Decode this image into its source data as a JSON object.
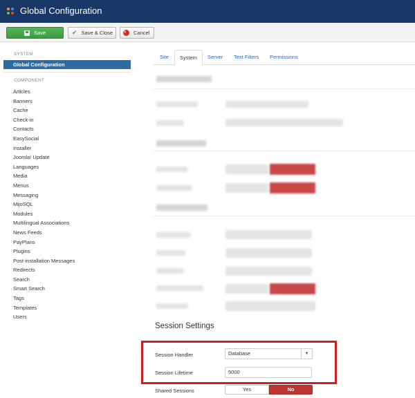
{
  "header": {
    "title": "Global Configuration",
    "logo_icon": "joomla-logo-icon"
  },
  "toolbar": {
    "save_label": "Save",
    "save_close_label": "Save & Close",
    "cancel_label": "Cancel"
  },
  "sidebar": {
    "system_heading": "SYSTEM",
    "active_item": "Global Configuration",
    "component_heading": "COMPONENT",
    "items": [
      "Articles",
      "Banners",
      "Cache",
      "Check-in",
      "Contacts",
      "EasySocial",
      "Installer",
      "Joomla! Update",
      "Languages",
      "Media",
      "Menus",
      "Messaging",
      "MijoSQL",
      "Modules",
      "Multilingual Associations",
      "News Feeds",
      "PayPlans",
      "Plugins",
      "Post-installation Messages",
      "Redirects",
      "Search",
      "Smart Search",
      "Tags",
      "Templates",
      "Users"
    ]
  },
  "tabs": [
    "Site",
    "System",
    "Server",
    "Text Filters",
    "Permissions"
  ],
  "active_tab": "System",
  "session": {
    "title": "Session Settings",
    "handler_label": "Session Handler",
    "handler_value": "Database",
    "lifetime_label": "Session Lifetime",
    "lifetime_value": "5000",
    "shared_label": "Shared Sessions",
    "shared_yes": "Yes",
    "shared_no": "No",
    "shared_selected": "No"
  },
  "colors": {
    "header": "#1a3867",
    "active": "#2d6ca2",
    "save": "#47a447",
    "danger": "#bd362f",
    "highlight": "#cc1f1f"
  }
}
